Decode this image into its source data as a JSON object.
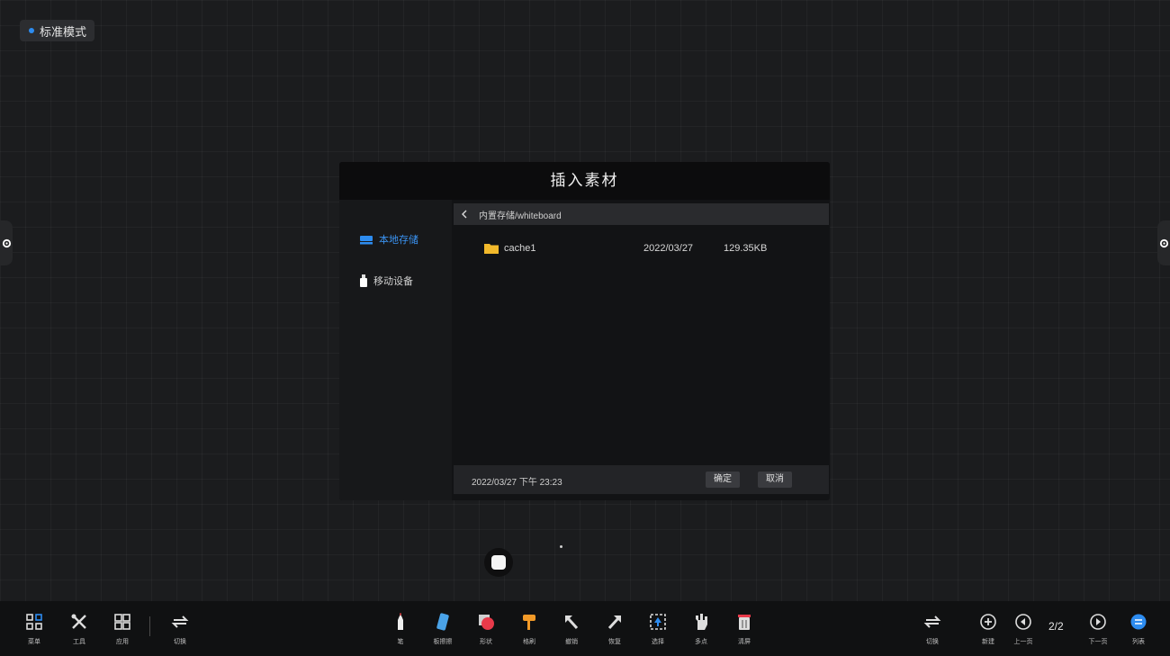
{
  "mode": {
    "label": "标准模式",
    "accent": "#2d8cf0"
  },
  "dialog": {
    "title": "插入素材",
    "sidebar": {
      "local": "本地存储",
      "removable": "移动设备"
    },
    "path": "内置存储/whiteboard",
    "files": [
      {
        "name": "cache1",
        "date": "2022/03/27",
        "size": "129.35KB"
      }
    ],
    "footer_time": "2022/03/27 下午 23:23",
    "ok_label": "确定",
    "cancel_label": "取消"
  },
  "toolbar": {
    "left": [
      {
        "icon": "menu-grid-icon",
        "label": "菜单"
      },
      {
        "icon": "tools-icon",
        "label": "工具"
      },
      {
        "icon": "apps-icon",
        "label": "应用"
      },
      {
        "icon": "switch-icon",
        "label": "切换"
      }
    ],
    "center": [
      {
        "icon": "pen-icon",
        "label": "笔"
      },
      {
        "icon": "eraser-icon",
        "label": "板擦擦"
      },
      {
        "icon": "shape-icon",
        "label": "形状"
      },
      {
        "icon": "brush-icon",
        "label": "格刷"
      },
      {
        "icon": "undo-icon",
        "label": "撤销"
      },
      {
        "icon": "redo-icon",
        "label": "恢复"
      },
      {
        "icon": "select-icon",
        "label": "选择"
      },
      {
        "icon": "hand-icon",
        "label": "多点"
      },
      {
        "icon": "clear-icon",
        "label": "清屏"
      }
    ],
    "right": [
      {
        "icon": "switch-icon",
        "label": "切换"
      },
      {
        "icon": "new-page-icon",
        "label": "新建"
      },
      {
        "icon": "prev-page-icon",
        "label": "上一页"
      },
      {
        "icon": "next-page-icon",
        "label": "下一页"
      },
      {
        "icon": "page-list-icon",
        "label": "列表"
      }
    ],
    "page": "2/2"
  }
}
